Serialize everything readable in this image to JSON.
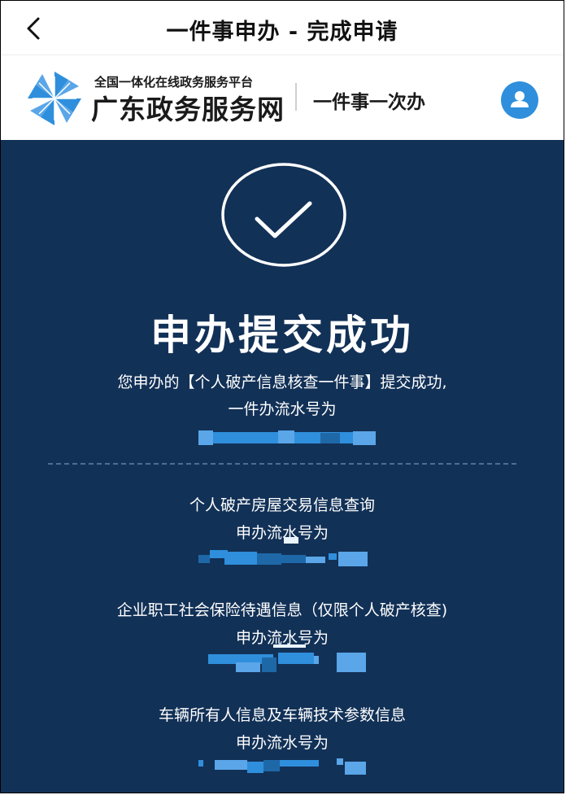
{
  "header": {
    "title": "一件事申办 - 完成申请",
    "back_icon": "chevron-left-icon"
  },
  "brand": {
    "subtitle": "全国一体化在线政务服务平台",
    "name": "广东政务服务网",
    "slogan": "一件事一次办",
    "logo_icon": "pinwheel-logo-icon",
    "avatar_icon": "user-icon",
    "accent_color": "#2f8fdc"
  },
  "result": {
    "status_icon": "checkmark-circle-icon",
    "title": "申办提交成功",
    "message_line1": "您申办的【个人破产信息核查一件事】提交成功,",
    "message_line2": "一件办流水号为",
    "background_color": "#123157"
  },
  "items": [
    {
      "name": "个人破产房屋交易信息查询",
      "label": "申办流水号为"
    },
    {
      "name": "企业职工社会保险待遇信息（仅限个人破产核查)",
      "label": "申办流水号为"
    },
    {
      "name": "车辆所有人信息及车辆技术参数信息",
      "label": "申办流水号为"
    }
  ]
}
